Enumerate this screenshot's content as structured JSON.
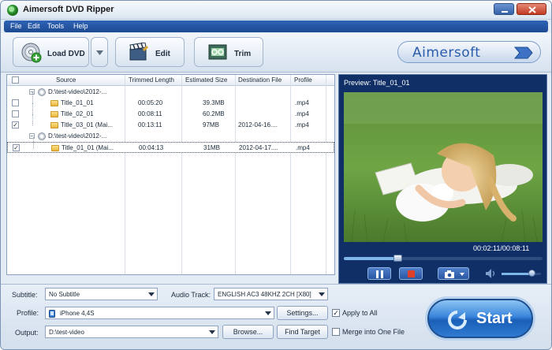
{
  "window": {
    "title": "Aimersoft DVD Ripper"
  },
  "menu": [
    "File",
    "Edit",
    "Tools",
    "Help"
  ],
  "toolbar": {
    "load_dvd": "Load DVD",
    "edit": "Edit",
    "trim": "Trim"
  },
  "brand": {
    "logo_text": "Aimersoft"
  },
  "file_list": {
    "columns": [
      "Source",
      "Trimmed Length",
      "Estimated Size",
      "Destination File",
      "Profile"
    ],
    "rows": [
      {
        "kind": "disc",
        "expanded": true,
        "source": "D:\\test-video\\2012-...",
        "length": "",
        "size": "",
        "dest": "",
        "profile": "",
        "checked": null
      },
      {
        "kind": "title",
        "source": "Title_01_01",
        "length": "00:05:20",
        "size": "39.3MB",
        "dest": "",
        "profile": ".mp4",
        "checked": false
      },
      {
        "kind": "title",
        "source": "Title_02_01",
        "length": "00:08:11",
        "size": "60.2MB",
        "dest": "",
        "profile": ".mp4",
        "checked": false
      },
      {
        "kind": "title",
        "source": "Title_03_01 (Mai...",
        "length": "00:13:11",
        "size": "97MB",
        "dest": "2012-04-16....",
        "profile": ".mp4",
        "checked": true
      },
      {
        "kind": "disc",
        "expanded": true,
        "source": "D:\\test-video\\2012-...",
        "length": "",
        "size": "",
        "dest": "",
        "profile": "",
        "checked": null
      },
      {
        "kind": "title",
        "source": "Title_01_01 (Mai...",
        "length": "00:04:13",
        "size": "31MB",
        "dest": "2012-04-17....",
        "profile": ".mp4",
        "checked": true,
        "selected": true
      }
    ]
  },
  "preview": {
    "title": "Preview: Title_01_01",
    "time": "00:02:11/00:08:11",
    "progress": 0.27,
    "volume": 0.75
  },
  "settings": {
    "subtitle_label": "Subtitle:",
    "subtitle_value": "No Subtitle",
    "audio_label": "Audio Track:",
    "audio_value": "ENGLISH AC3 48KHZ 2CH [X80]",
    "profile_label": "Profile:",
    "profile_value": "iPhone 4,4S",
    "settings_button": "Settings...",
    "apply_all": "Apply to All",
    "apply_all_checked": true,
    "output_label": "Output:",
    "output_value": "D:\\test-video",
    "browse_button": "Browse...",
    "find_target_button": "Find Target",
    "merge_label": "Merge into One File",
    "merge_checked": false
  },
  "start": {
    "label": "Start"
  },
  "colors": {
    "accent": "#1f4f8f",
    "menu": "#2f63b6",
    "preview_bg": "#0f2f66"
  }
}
